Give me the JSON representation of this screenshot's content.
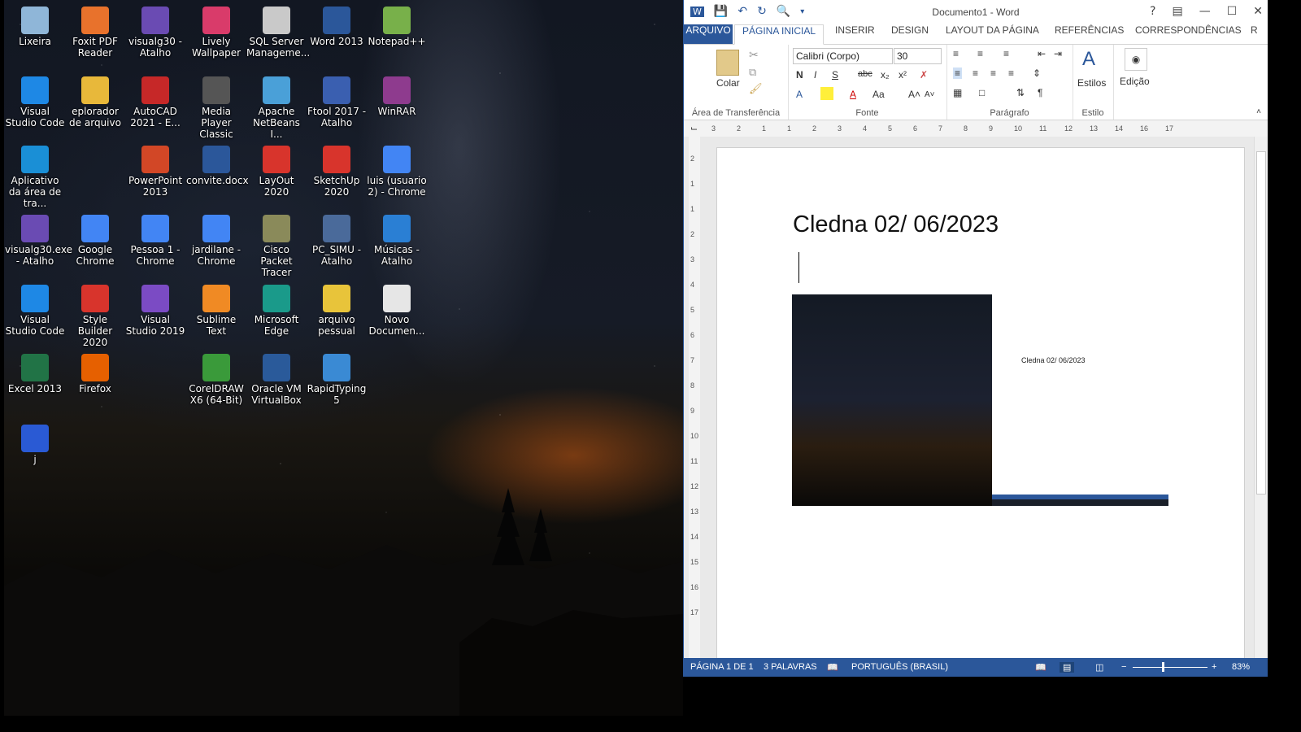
{
  "desktop": {
    "icons": [
      {
        "label": "Lixeira",
        "icon": "recycle-bin-icon",
        "color": "#8fb6d8"
      },
      {
        "label": "Foxit PDF Reader",
        "icon": "foxit-pdf-icon",
        "color": "#e8722c"
      },
      {
        "label": "visualg30 - Atalho",
        "icon": "visualg-icon",
        "color": "#6a4bb3"
      },
      {
        "label": "Lively Wallpaper",
        "icon": "lively-wallpaper-icon",
        "color": "#d93b6a"
      },
      {
        "label": "SQL Server Manageme...",
        "icon": "sql-server-icon",
        "color": "#c9c9c9"
      },
      {
        "label": "Word 2013",
        "icon": "word-icon",
        "color": "#2b579a"
      },
      {
        "label": "Notepad++",
        "icon": "notepadpp-icon",
        "color": "#78b04a"
      },
      {
        "label": "Visual Studio Code",
        "icon": "vscode-icon",
        "color": "#1e88e5"
      },
      {
        "label": "eplorador de arquivo",
        "icon": "folder-icon",
        "color": "#e8b83a"
      },
      {
        "label": "AutoCAD 2021 - E...",
        "icon": "autocad-icon",
        "color": "#c62828"
      },
      {
        "label": "Media Player Classic",
        "icon": "media-player-icon",
        "color": "#555555"
      },
      {
        "label": "Apache NetBeans I...",
        "icon": "netbeans-icon",
        "color": "#4aa0d8"
      },
      {
        "label": "Ftool 2017 - Atalho",
        "icon": "ftool-icon",
        "color": "#3a5fb0"
      },
      {
        "label": "WinRAR",
        "icon": "winrar-icon",
        "color": "#8e3b8e"
      },
      {
        "label": "Aplicativo da área de tra...",
        "icon": "autodesk-app-icon",
        "color": "#1a8fd6"
      },
      {
        "label": "PowerPoint 2013",
        "icon": "powerpoint-icon",
        "color": "#d24726"
      },
      {
        "label": "convite.docx",
        "icon": "word-document-icon",
        "color": "#2b579a"
      },
      {
        "label": "LayOut 2020",
        "icon": "layout-icon",
        "color": "#d8342c"
      },
      {
        "label": "SketchUp 2020",
        "icon": "sketchup-icon",
        "color": "#d8342c"
      },
      {
        "label": "luis (usuario 2) - Chrome",
        "icon": "chrome-profile-icon",
        "color": "#4285f4"
      },
      {
        "label": "visualg30.exe - Atalho",
        "icon": "visualg-icon",
        "color": "#6a4bb3"
      },
      {
        "label": "Google Chrome",
        "icon": "chrome-icon",
        "color": "#4285f4"
      },
      {
        "label": "Pessoa 1 - Chrome",
        "icon": "chrome-profile-icon",
        "color": "#4285f4"
      },
      {
        "label": "jardilane - Chrome",
        "icon": "chrome-profile-icon",
        "color": "#4285f4"
      },
      {
        "label": "Cisco Packet Tracer",
        "icon": "cisco-packet-tracer-icon",
        "color": "#8a8a5a"
      },
      {
        "label": "PC_SIMU - Atalho",
        "icon": "pc-simu-icon",
        "color": "#4a6a9a"
      },
      {
        "label": "Músicas - Atalho",
        "icon": "music-folder-icon",
        "color": "#2a7fd4"
      },
      {
        "label": "Visual Studio Code",
        "icon": "vscode-icon",
        "color": "#1e88e5"
      },
      {
        "label": "Style Builder 2020",
        "icon": "style-builder-icon",
        "color": "#d8342c"
      },
      {
        "label": "Visual Studio 2019",
        "icon": "visual-studio-icon",
        "color": "#7b4bc4"
      },
      {
        "label": "Sublime Text",
        "icon": "sublime-text-icon",
        "color": "#f08a24"
      },
      {
        "label": "Microsoft Edge",
        "icon": "edge-icon",
        "color": "#1a9a8a"
      },
      {
        "label": "arquivo pessual",
        "icon": "unknown-file-icon",
        "color": "#e8c43a"
      },
      {
        "label": "Novo Documen...",
        "icon": "text-document-icon",
        "color": "#e6e6e6"
      },
      {
        "label": "Excel 2013",
        "icon": "excel-icon",
        "color": "#217346"
      },
      {
        "label": "Firefox",
        "icon": "firefox-icon",
        "color": "#e66000"
      },
      {
        "label": "CorelDRAW X6 (64-Bit)",
        "icon": "coreldraw-icon",
        "color": "#3a9a3a"
      },
      {
        "label": "Oracle VM VirtualBox",
        "icon": "virtualbox-icon",
        "color": "#2a5a9a"
      },
      {
        "label": "RapidTyping 5",
        "icon": "rapidtyping-icon",
        "color": "#3a8ad4"
      },
      {
        "label": "j",
        "icon": "typora-icon",
        "color": "#2a5ad4"
      }
    ]
  },
  "word": {
    "window_title": "Documento1 - Word",
    "help": "?",
    "tabs": [
      "ARQUIVO",
      "PÁGINA INICIAL",
      "INSERIR",
      "DESIGN",
      "LAYOUT DA PÁGINA",
      "REFERÊNCIAS",
      "CORRESPONDÊNCIAS",
      "R"
    ],
    "ribbon": {
      "paste_label": "Colar",
      "clipboard_group": "Área de Transferência",
      "font_name": "Calibri (Corpo)",
      "font_size": "30",
      "font_group": "Fonte",
      "paragraph_group": "Parágrafo",
      "styles_label": "Estilos",
      "style_group": "Estilo",
      "edit_label": "Edição",
      "bold": "N",
      "italic": "I",
      "underline": "S",
      "strike": "abc",
      "subscript": "x₂",
      "superscript": "x²",
      "case": "Aa"
    },
    "ruler_numbers": [
      "3",
      "2",
      "1",
      "1",
      "2",
      "3",
      "4",
      "5",
      "6",
      "7",
      "8",
      "9",
      "10",
      "11",
      "12",
      "13",
      "14",
      "16",
      "17"
    ],
    "vruler_numbers": [
      "2",
      "1",
      "1",
      "2",
      "3",
      "4",
      "5",
      "6",
      "7",
      "8",
      "9",
      "10",
      "11",
      "12",
      "13",
      "14",
      "15",
      "16",
      "17"
    ],
    "document": {
      "heading": "Cledna 02/ 06/2023",
      "embedded_heading": "Cledna 02/ 06/2023"
    },
    "status": {
      "page": "PÁGINA 1 DE 1",
      "words": "3 PALAVRAS",
      "language": "PORTUGUÊS (BRASIL)",
      "zoom": "83%"
    }
  }
}
